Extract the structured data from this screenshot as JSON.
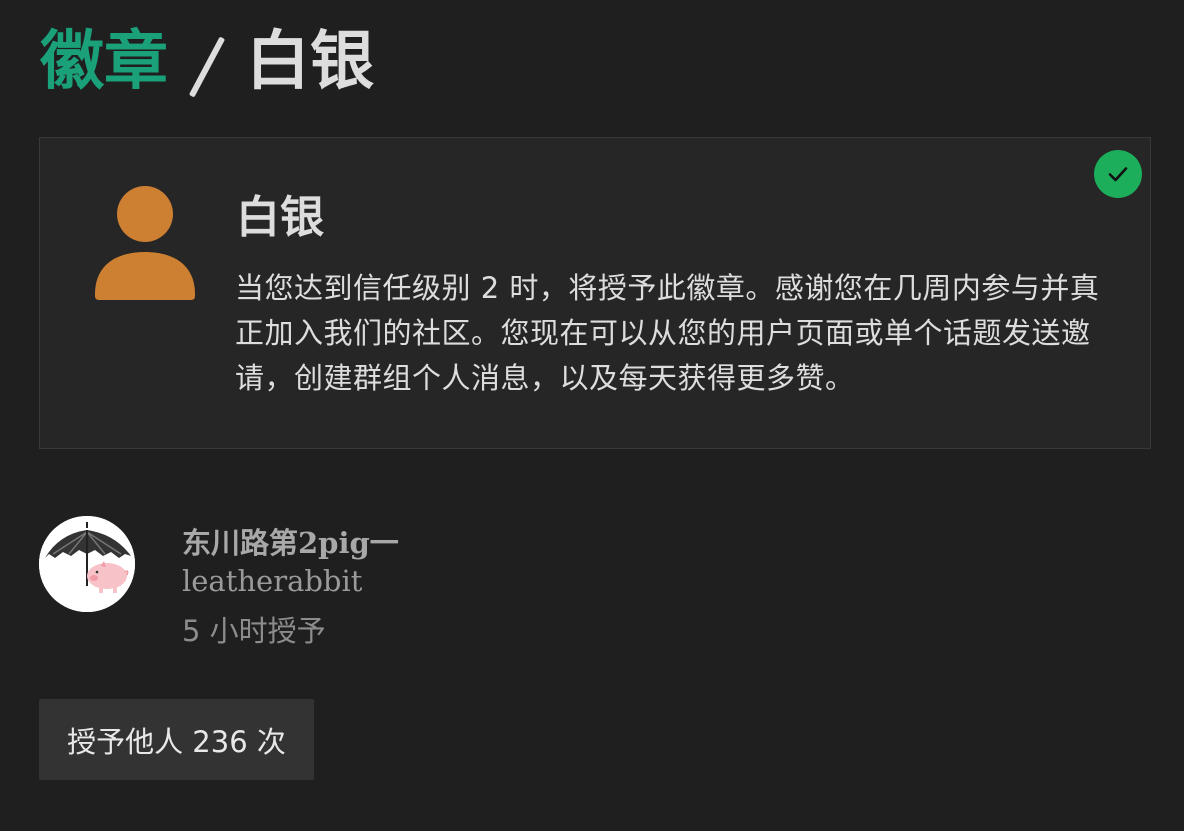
{
  "breadcrumb": {
    "parent": "徽章",
    "current": "白银"
  },
  "badge": {
    "name": "白银",
    "description": "当您达到信任级别 2 时，将授予此徽章。感谢您在几周内参与并真正加入我们的社区。您现在可以从您的用户页面或单个话题发送邀请，创建群组个人消息，以及每天获得更多赞。",
    "icon": "user-icon",
    "icon_color": "#cd7f32",
    "granted_icon": "check-icon",
    "granted_color": "#1cae5a"
  },
  "grantee": {
    "name": "东川路第2pig一",
    "username": "leatherabbit",
    "granted_time": "5 小时授予",
    "avatar_icon": "umbrella-pig-avatar"
  },
  "granted_count_label": "授予他人 236 次",
  "colors": {
    "accent": "#1aa17a",
    "background": "#1f1f1f"
  }
}
